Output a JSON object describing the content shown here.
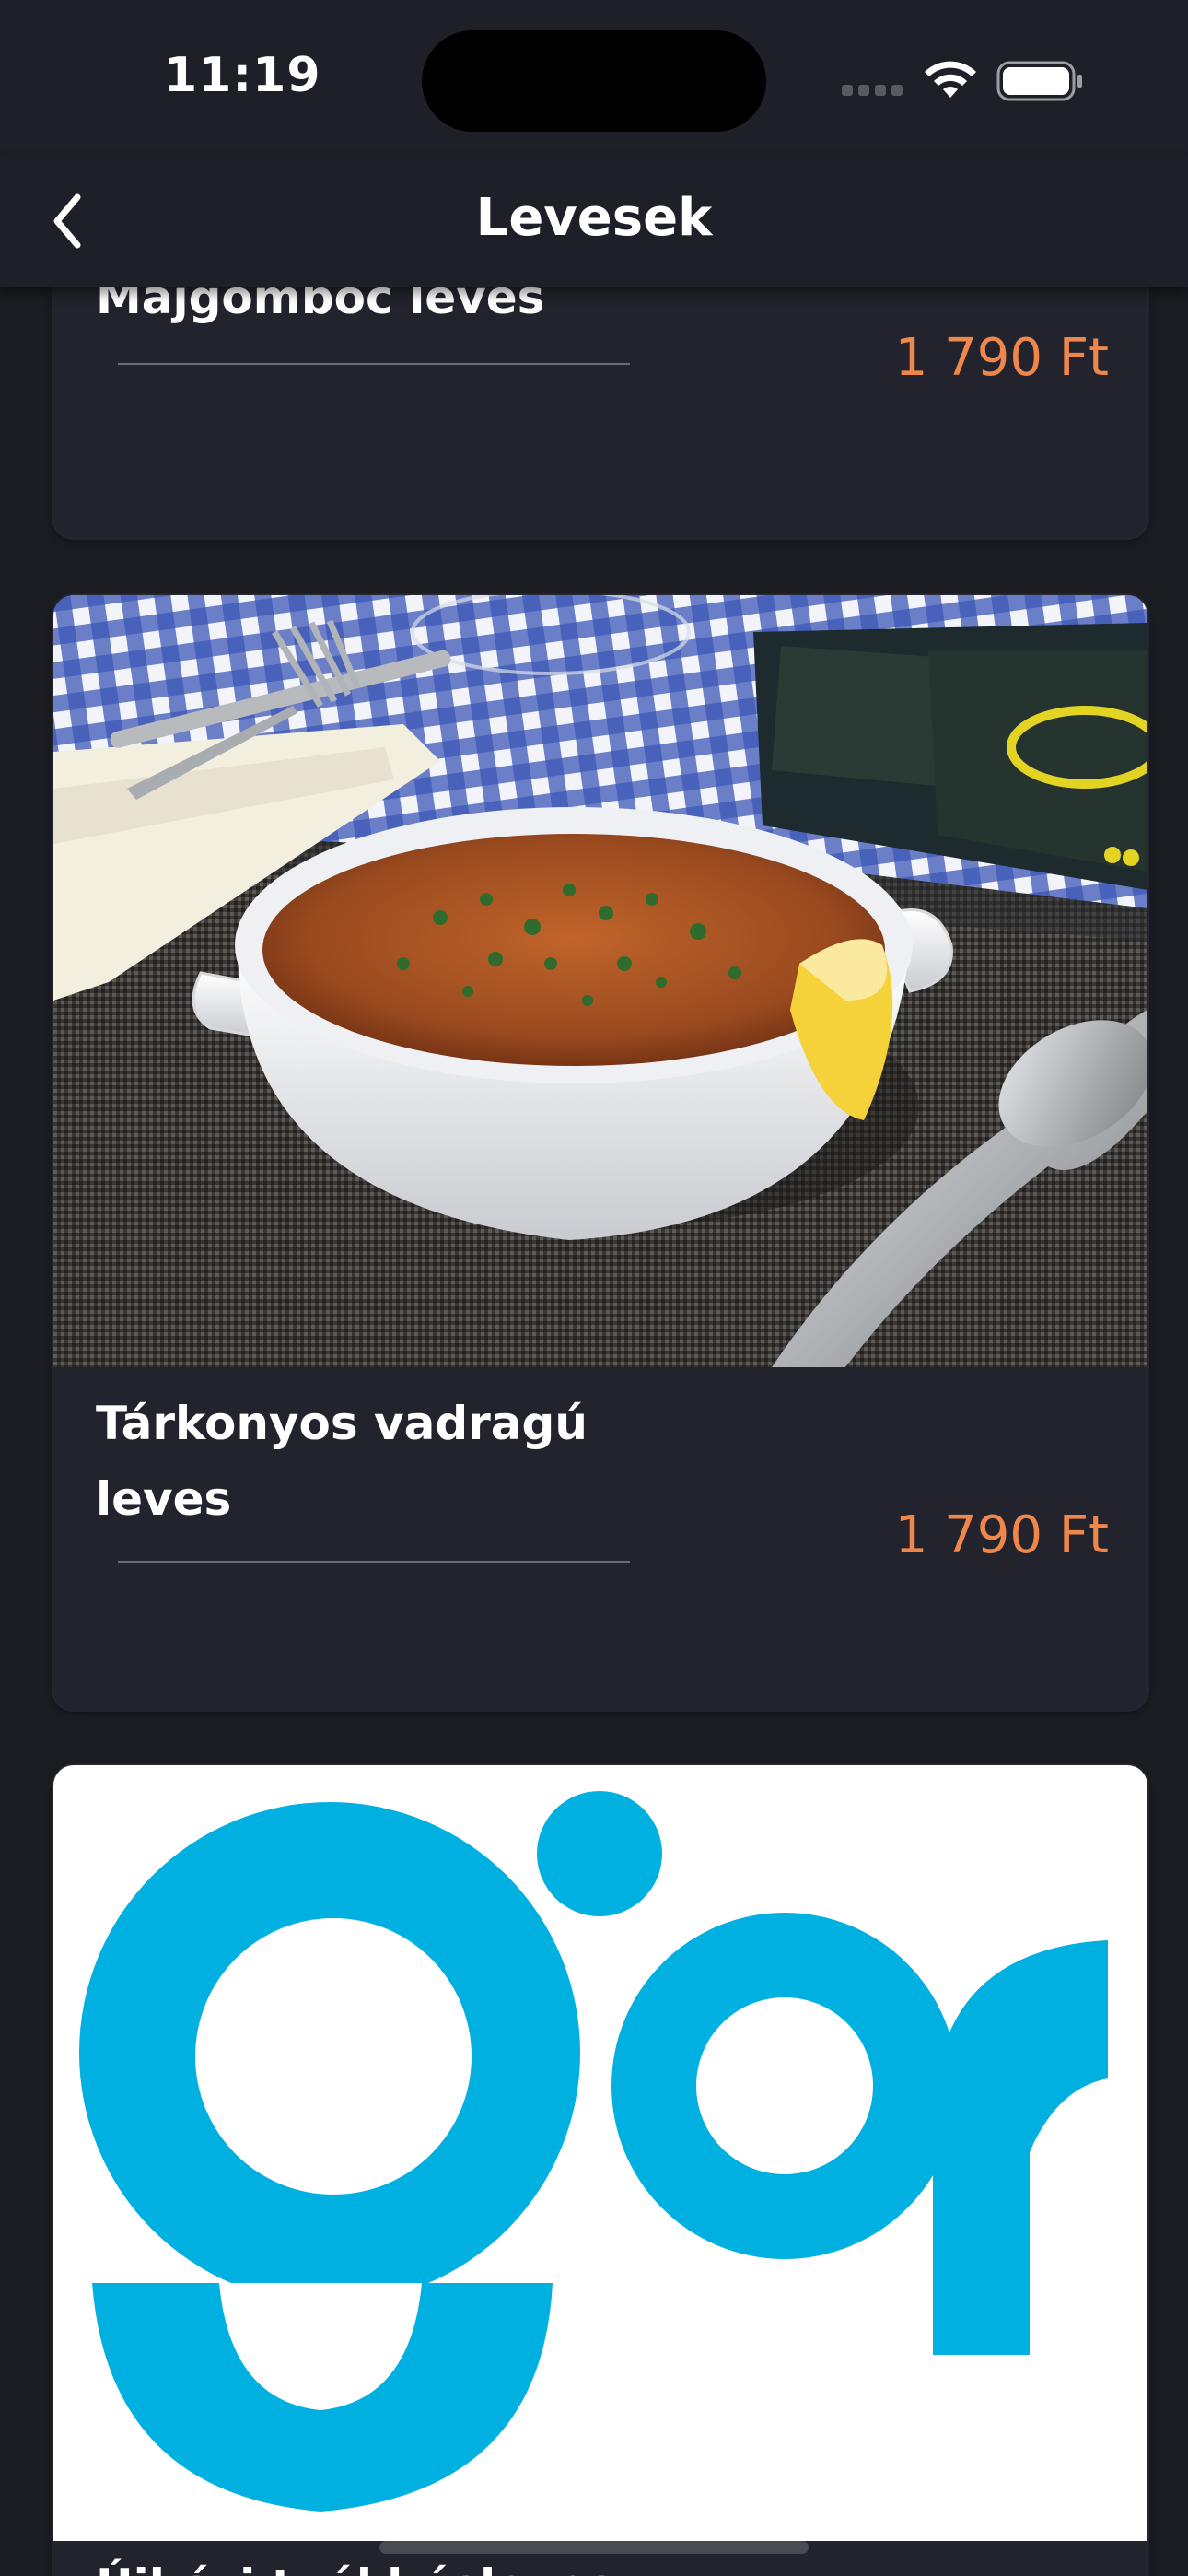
{
  "status": {
    "time": "11:19"
  },
  "nav": {
    "title": "Levesek",
    "back_icon": "chevron-left-icon"
  },
  "items": [
    {
      "name": "Májgombóc leves",
      "price": "1 790 Ft"
    },
    {
      "name": "Tárkonyos vadragú leves",
      "price": "1 790 Ft"
    },
    {
      "name": "Újházi tyúkhúsleves",
      "price": ""
    }
  ],
  "colors": {
    "background": "#1b1c22",
    "card": "#22232c",
    "price": "#f0874a",
    "logo": "#00b0e0"
  }
}
